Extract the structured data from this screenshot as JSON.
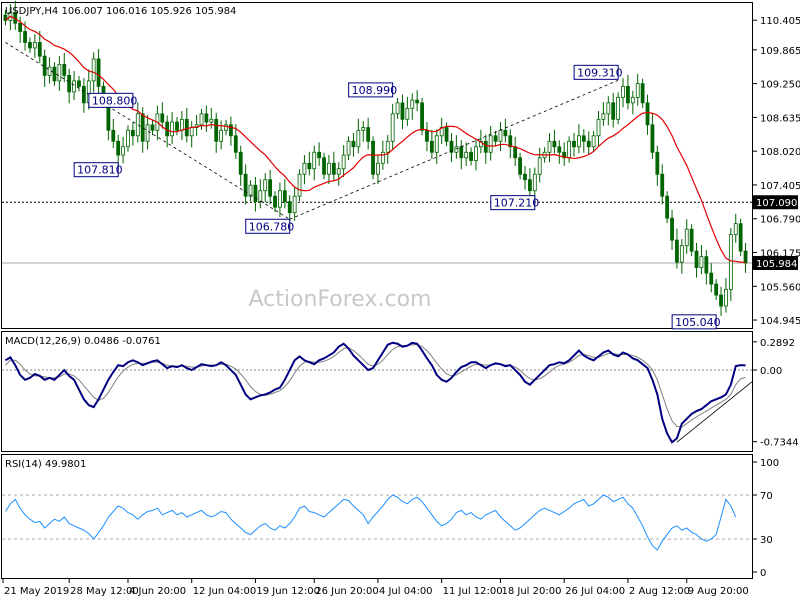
{
  "chart_data": {
    "type": "candlestick",
    "symbol_header": "USDJPY,H4  106.007 106.016 105.926 105.984",
    "watermark": "ActionForex.com",
    "colors": {
      "candle": "#006400",
      "ma": "#e00000",
      "macd": "#000080",
      "signal": "#808080",
      "rsi": "#1e90ff",
      "annotation_border": "#000080",
      "annotation_text": "#000080",
      "trendline": "#000000"
    },
    "price_panel": {
      "y_ticks": [
        "110.405",
        "109.865",
        "109.250",
        "108.635",
        "108.020",
        "107.405",
        "106.790",
        "106.175",
        "105.560",
        "104.945"
      ],
      "ylim": [
        104.8,
        110.7
      ],
      "levels": [
        {
          "label": "107.090",
          "value": 107.09,
          "style": "dotted"
        },
        {
          "label": "105.984",
          "value": 105.984,
          "style": "solid"
        }
      ],
      "annotations": [
        {
          "label": "108.800",
          "value": 108.8,
          "idx": 26
        },
        {
          "label": "107.810",
          "value": 107.81,
          "idx": 23
        },
        {
          "label": "106.780",
          "value": 106.78,
          "idx": 58
        },
        {
          "label": "108.990",
          "value": 108.99,
          "idx": 79
        },
        {
          "label": "107.210",
          "value": 107.21,
          "idx": 108
        },
        {
          "label": "109.310",
          "value": 109.31,
          "idx": 125
        },
        {
          "label": "105.040",
          "value": 105.04,
          "idx": 145
        }
      ],
      "closes": [
        110.4,
        110.55,
        110.35,
        110.2,
        110.0,
        109.9,
        110.0,
        109.75,
        109.4,
        109.55,
        109.3,
        109.6,
        109.4,
        109.1,
        109.3,
        109.2,
        108.9,
        109.3,
        109.7,
        109.2,
        108.9,
        108.4,
        108.2,
        107.95,
        108.1,
        108.4,
        108.3,
        108.7,
        108.2,
        108.5,
        108.4,
        108.7,
        108.55,
        108.3,
        108.55,
        108.4,
        108.6,
        108.3,
        108.45,
        108.5,
        108.7,
        108.55,
        108.6,
        108.2,
        108.4,
        108.5,
        108.3,
        108.0,
        107.6,
        107.2,
        107.4,
        107.1,
        107.3,
        107.5,
        107.2,
        107.0,
        107.3,
        107.1,
        106.9,
        107.2,
        107.6,
        107.8,
        107.7,
        108.0,
        107.9,
        107.6,
        107.8,
        107.6,
        107.7,
        107.95,
        108.2,
        108.1,
        108.4,
        108.45,
        108.2,
        107.6,
        107.8,
        108.0,
        108.2,
        108.7,
        108.9,
        108.6,
        108.8,
        108.95,
        108.9,
        108.4,
        108.2,
        108.0,
        108.3,
        108.45,
        108.2,
        108.0,
        108.1,
        107.9,
        108.0,
        107.85,
        108.1,
        108.2,
        108.0,
        108.3,
        108.2,
        108.4,
        108.3,
        108.1,
        107.9,
        107.6,
        107.5,
        107.3,
        107.6,
        107.9,
        108.0,
        108.2,
        108.1,
        108.0,
        107.9,
        108.2,
        108.1,
        108.3,
        108.2,
        108.1,
        108.3,
        108.6,
        108.7,
        108.9,
        108.6,
        109.0,
        109.2,
        108.9,
        109.0,
        109.25,
        108.9,
        108.5,
        108.0,
        107.6,
        107.2,
        106.8,
        106.4,
        106.0,
        106.3,
        106.6,
        106.2,
        105.9,
        106.1,
        105.8,
        105.6,
        105.4,
        105.2,
        105.5,
        106.5,
        106.7,
        106.2,
        105.984
      ]
    },
    "macd_panel": {
      "label": "MACD(12,26,9) 0.0486 -0.0761",
      "y_ticks": [
        "0.2892",
        "0.00",
        "-0.7344"
      ],
      "ylim": [
        -0.83,
        0.38
      ],
      "macd": [
        0.1,
        0.13,
        0.05,
        -0.05,
        -0.1,
        -0.08,
        -0.04,
        -0.06,
        -0.1,
        -0.08,
        -0.1,
        -0.05,
        0.0,
        -0.06,
        -0.1,
        -0.2,
        -0.3,
        -0.36,
        -0.38,
        -0.3,
        -0.2,
        -0.1,
        -0.02,
        0.05,
        0.04,
        0.08,
        0.1,
        0.08,
        0.05,
        0.07,
        0.09,
        0.1,
        0.06,
        0.02,
        0.04,
        0.03,
        0.05,
        0.02,
        0.0,
        0.03,
        0.06,
        0.05,
        0.04,
        0.05,
        0.08,
        0.05,
        0.0,
        -0.05,
        -0.15,
        -0.25,
        -0.3,
        -0.28,
        -0.26,
        -0.25,
        -0.23,
        -0.2,
        -0.18,
        -0.1,
        0.0,
        0.1,
        0.14,
        0.1,
        0.08,
        0.06,
        0.1,
        0.12,
        0.15,
        0.18,
        0.24,
        0.27,
        0.22,
        0.15,
        0.1,
        0.05,
        0.0,
        0.02,
        0.1,
        0.18,
        0.26,
        0.28,
        0.27,
        0.24,
        0.25,
        0.28,
        0.27,
        0.2,
        0.12,
        0.05,
        -0.05,
        -0.1,
        -0.12,
        -0.08,
        -0.02,
        0.03,
        0.05,
        0.08,
        0.08,
        0.05,
        0.02,
        0.05,
        0.07,
        0.06,
        0.04,
        0.05,
        0.0,
        -0.05,
        -0.12,
        -0.15,
        -0.1,
        -0.05,
        0.0,
        0.05,
        0.06,
        0.08,
        0.07,
        0.1,
        0.15,
        0.2,
        0.15,
        0.12,
        0.1,
        0.14,
        0.18,
        0.2,
        0.16,
        0.14,
        0.18,
        0.16,
        0.12,
        0.1,
        0.06,
        0.02,
        -0.1,
        -0.25,
        -0.5,
        -0.65,
        -0.74,
        -0.7,
        -0.55,
        -0.5,
        -0.45,
        -0.42,
        -0.4,
        -0.36,
        -0.32,
        -0.3,
        -0.28,
        -0.25,
        -0.15,
        0.04,
        0.05,
        0.0486
      ],
      "signal": [
        0.05,
        0.1,
        0.1,
        0.06,
        0.0,
        -0.04,
        -0.06,
        -0.06,
        -0.07,
        -0.08,
        -0.08,
        -0.07,
        -0.04,
        -0.04,
        -0.06,
        -0.1,
        -0.16,
        -0.22,
        -0.28,
        -0.31,
        -0.29,
        -0.23,
        -0.15,
        -0.07,
        -0.01,
        0.03,
        0.06,
        0.07,
        0.07,
        0.07,
        0.08,
        0.08,
        0.07,
        0.05,
        0.04,
        0.04,
        0.04,
        0.04,
        0.03,
        0.03,
        0.04,
        0.05,
        0.05,
        0.05,
        0.06,
        0.06,
        0.04,
        0.01,
        -0.04,
        -0.1,
        -0.17,
        -0.22,
        -0.25,
        -0.26,
        -0.25,
        -0.23,
        -0.21,
        -0.17,
        -0.11,
        -0.03,
        0.04,
        0.08,
        0.09,
        0.08,
        0.08,
        0.09,
        0.11,
        0.14,
        0.18,
        0.22,
        0.23,
        0.2,
        0.16,
        0.11,
        0.06,
        0.04,
        0.06,
        0.1,
        0.16,
        0.21,
        0.24,
        0.25,
        0.25,
        0.26,
        0.26,
        0.24,
        0.2,
        0.14,
        0.07,
        0.01,
        -0.04,
        -0.06,
        -0.05,
        -0.02,
        0.01,
        0.04,
        0.06,
        0.06,
        0.05,
        0.05,
        0.06,
        0.06,
        0.05,
        0.05,
        0.03,
        0.0,
        -0.05,
        -0.09,
        -0.1,
        -0.09,
        -0.06,
        -0.02,
        0.02,
        0.05,
        0.06,
        0.08,
        0.11,
        0.15,
        0.16,
        0.15,
        0.13,
        0.13,
        0.15,
        0.17,
        0.17,
        0.16,
        0.16,
        0.16,
        0.15,
        0.13,
        0.1,
        0.06,
        0.0,
        -0.1,
        -0.25,
        -0.4,
        -0.52,
        -0.58,
        -0.58,
        -0.55,
        -0.51,
        -0.48,
        -0.45,
        -0.42,
        -0.39,
        -0.36,
        -0.33,
        -0.3,
        -0.25,
        -0.15,
        -0.09,
        -0.0761
      ]
    },
    "rsi_panel": {
      "label": "RSI(14) 49.9801",
      "y_ticks": [
        "100",
        "70",
        "30",
        "0"
      ],
      "ylim": [
        0,
        100
      ],
      "levels": [
        70,
        30
      ],
      "values": [
        55,
        62,
        66,
        58,
        52,
        48,
        45,
        46,
        40,
        44,
        48,
        46,
        50,
        44,
        42,
        40,
        38,
        35,
        30,
        36,
        42,
        50,
        55,
        60,
        58,
        54,
        52,
        48,
        52,
        55,
        56,
        58,
        52,
        54,
        56,
        52,
        54,
        50,
        52,
        54,
        56,
        52,
        50,
        52,
        55,
        54,
        48,
        44,
        40,
        36,
        34,
        38,
        42,
        44,
        40,
        38,
        42,
        40,
        44,
        50,
        58,
        60,
        55,
        54,
        52,
        50,
        54,
        58,
        62,
        66,
        65,
        60,
        56,
        52,
        44,
        50,
        55,
        60,
        66,
        70,
        68,
        64,
        62,
        66,
        68,
        64,
        58,
        52,
        46,
        42,
        44,
        48,
        54,
        56,
        52,
        54,
        50,
        48,
        52,
        54,
        56,
        50,
        46,
        42,
        38,
        40,
        44,
        48,
        52,
        56,
        58,
        56,
        54,
        52,
        55,
        58,
        62,
        64,
        66,
        60,
        62,
        66,
        70,
        68,
        64,
        66,
        68,
        62,
        58,
        50,
        42,
        32,
        24,
        20,
        28,
        34,
        40,
        42,
        38,
        40,
        36,
        34,
        30,
        28,
        30,
        34,
        50,
        66,
        60,
        49.9801
      ]
    },
    "x_ticks": [
      "21 May 2019",
      "28 May 12:00",
      "4 Jun 20:00",
      "12 Jun 04:00",
      "19 Jun 12:00",
      "26 Jun 20:00",
      "4 Jul 04:00",
      "11 Jul 12:00",
      "18 Jul 20:00",
      "26 Jul 04:00",
      "2 Aug 12:00",
      "9 Aug 20:00"
    ]
  }
}
